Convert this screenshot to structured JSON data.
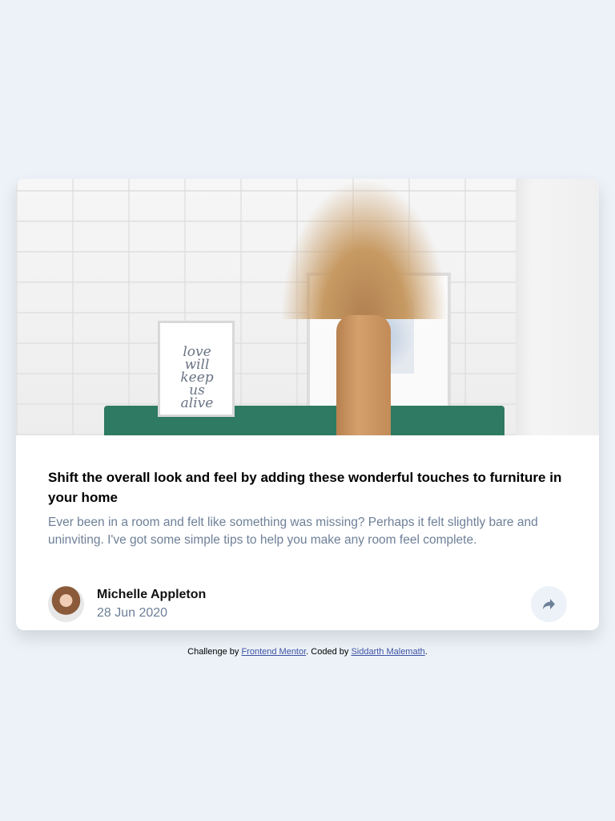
{
  "card": {
    "image_alt": "Drawers with a vase and picture frames",
    "frame_text": "love will keep us alive",
    "title": "Shift the overall look and feel by adding these wonderful touches to furniture in your home",
    "description": "Ever been in a room and felt like something was missing? Perhaps it felt slightly bare and uninviting. I've got some simple tips to help you make any room feel complete.",
    "author": {
      "name": "Michelle Appleton",
      "date": "28 Jun 2020"
    },
    "share_icon": "share-icon"
  },
  "footer": {
    "prefix": "Challenge by ",
    "link1": "Frontend Mentor",
    "middle": ". Coded by ",
    "link2": "Siddarth Malemath",
    "suffix": "."
  },
  "colors": {
    "background": "#ecf2f8",
    "muted_text": "#6e8098",
    "link": "#3e52a3"
  }
}
